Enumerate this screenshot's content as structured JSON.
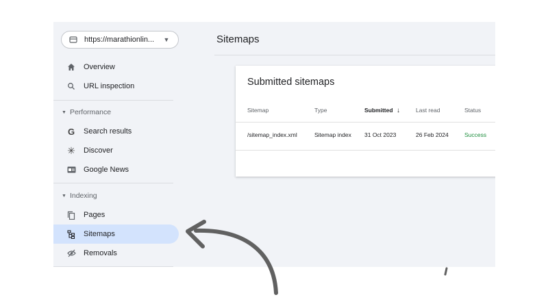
{
  "property": {
    "url": "https://marathionlin...",
    "icon": "property-site-icon"
  },
  "nav": {
    "overview": "Overview",
    "url_inspection": "URL inspection",
    "performance_section": "Performance",
    "search_results": "Search results",
    "discover": "Discover",
    "google_news": "Google News",
    "indexing_section": "Indexing",
    "pages": "Pages",
    "sitemaps": "Sitemaps",
    "removals": "Removals"
  },
  "page": {
    "title": "Sitemaps"
  },
  "card": {
    "title": "Submitted sitemaps",
    "columns": [
      "Sitemap",
      "Type",
      "Submitted",
      "Last read",
      "Status"
    ],
    "sort_column": "Submitted",
    "rows": [
      {
        "sitemap": "/sitemap_index.xml",
        "type": "Sitemap index",
        "submitted": "31 Oct 2023",
        "last_read": "26 Feb 2024",
        "status": "Success"
      }
    ]
  },
  "colors": {
    "active_nav": "#d3e3fd",
    "success": "#1e8e3e",
    "arrow": "#5f6368"
  }
}
